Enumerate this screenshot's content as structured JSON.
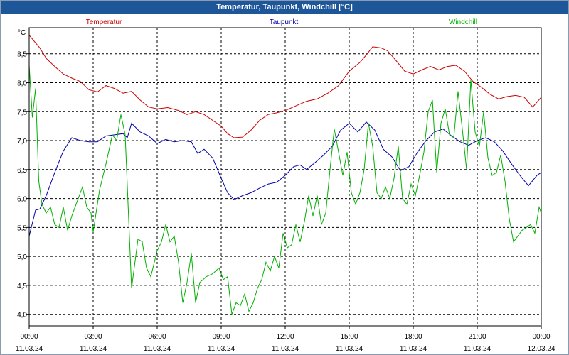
{
  "window": {
    "title": "Temperatur, Taupunkt, Windchill [°C]"
  },
  "chart_data": {
    "type": "line",
    "title": "Temperatur, Taupunkt, Windchill [°C]",
    "y_unit": "°C",
    "ylim": [
      3.8,
      8.95
    ],
    "y_ticks": [
      "4,0",
      "4,5",
      "5,0",
      "5,5",
      "6,0",
      "6,5",
      "7,0",
      "7,5",
      "8,0",
      "8,5"
    ],
    "y_tick_values": [
      4.0,
      4.5,
      5.0,
      5.5,
      6.0,
      6.5,
      7.0,
      7.5,
      8.0,
      8.5
    ],
    "x_range_hours": [
      0,
      24
    ],
    "x_ticks": [
      {
        "time": "00:00",
        "date": "11.03.24"
      },
      {
        "time": "03:00",
        "date": "11.03.24"
      },
      {
        "time": "06:00",
        "date": "11.03.24"
      },
      {
        "time": "09:00",
        "date": "11.03.24"
      },
      {
        "time": "12:00",
        "date": "11.03.24"
      },
      {
        "time": "15:00",
        "date": "11.03.24"
      },
      {
        "time": "18:00",
        "date": "11.03.24"
      },
      {
        "time": "21:00",
        "date": "11.03.24"
      },
      {
        "time": "00:00",
        "date": "12.03.24"
      }
    ],
    "grid": true,
    "legend_placement": "top",
    "series": [
      {
        "name": "Temperatur",
        "color": "#cc0000",
        "points": [
          [
            0,
            8.82
          ],
          [
            0.5,
            8.6
          ],
          [
            0.8,
            8.42
          ],
          [
            1.2,
            8.28
          ],
          [
            1.6,
            8.15
          ],
          [
            2.0,
            8.08
          ],
          [
            2.4,
            8.02
          ],
          [
            2.8,
            7.88
          ],
          [
            3.2,
            7.84
          ],
          [
            3.6,
            7.95
          ],
          [
            4.0,
            7.9
          ],
          [
            4.4,
            7.82
          ],
          [
            4.8,
            7.85
          ],
          [
            5.2,
            7.7
          ],
          [
            5.6,
            7.58
          ],
          [
            6.0,
            7.55
          ],
          [
            6.5,
            7.57
          ],
          [
            7.0,
            7.52
          ],
          [
            7.4,
            7.45
          ],
          [
            7.8,
            7.5
          ],
          [
            8.2,
            7.45
          ],
          [
            8.6,
            7.35
          ],
          [
            9.0,
            7.25
          ],
          [
            9.3,
            7.12
          ],
          [
            9.6,
            7.05
          ],
          [
            10.0,
            7.06
          ],
          [
            10.4,
            7.18
          ],
          [
            10.8,
            7.35
          ],
          [
            11.2,
            7.45
          ],
          [
            11.6,
            7.48
          ],
          [
            12.0,
            7.52
          ],
          [
            12.5,
            7.6
          ],
          [
            13.0,
            7.68
          ],
          [
            13.5,
            7.72
          ],
          [
            14.0,
            7.82
          ],
          [
            14.5,
            7.95
          ],
          [
            15.0,
            8.2
          ],
          [
            15.5,
            8.35
          ],
          [
            15.8,
            8.48
          ],
          [
            16.1,
            8.62
          ],
          [
            16.5,
            8.6
          ],
          [
            16.8,
            8.55
          ],
          [
            17.2,
            8.38
          ],
          [
            17.6,
            8.2
          ],
          [
            18.0,
            8.15
          ],
          [
            18.4,
            8.22
          ],
          [
            18.8,
            8.28
          ],
          [
            19.2,
            8.22
          ],
          [
            19.6,
            8.28
          ],
          [
            20.0,
            8.3
          ],
          [
            20.4,
            8.2
          ],
          [
            20.8,
            8.02
          ],
          [
            21.2,
            7.92
          ],
          [
            21.6,
            7.8
          ],
          [
            22.0,
            7.72
          ],
          [
            22.4,
            7.76
          ],
          [
            22.8,
            7.78
          ],
          [
            23.2,
            7.75
          ],
          [
            23.6,
            7.58
          ],
          [
            24.0,
            7.75
          ]
        ]
      },
      {
        "name": "Taupunkt",
        "color": "#0000aa",
        "points": [
          [
            0,
            5.35
          ],
          [
            0.3,
            5.8
          ],
          [
            0.5,
            5.82
          ],
          [
            0.8,
            6.05
          ],
          [
            1.2,
            6.45
          ],
          [
            1.6,
            6.82
          ],
          [
            2.0,
            7.05
          ],
          [
            2.4,
            7.0
          ],
          [
            2.8,
            6.98
          ],
          [
            3.2,
            6.98
          ],
          [
            3.6,
            7.08
          ],
          [
            4.0,
            7.1
          ],
          [
            4.4,
            7.12
          ],
          [
            4.6,
            7.05
          ],
          [
            4.8,
            7.3
          ],
          [
            5.2,
            7.15
          ],
          [
            5.6,
            7.08
          ],
          [
            6.0,
            6.95
          ],
          [
            6.4,
            7.02
          ],
          [
            6.8,
            6.98
          ],
          [
            7.2,
            7.0
          ],
          [
            7.6,
            6.98
          ],
          [
            7.9,
            6.78
          ],
          [
            8.2,
            6.85
          ],
          [
            8.6,
            6.7
          ],
          [
            9.0,
            6.35
          ],
          [
            9.3,
            6.1
          ],
          [
            9.6,
            5.98
          ],
          [
            10.0,
            6.05
          ],
          [
            10.4,
            6.1
          ],
          [
            10.8,
            6.18
          ],
          [
            11.2,
            6.25
          ],
          [
            11.6,
            6.28
          ],
          [
            12.0,
            6.4
          ],
          [
            12.4,
            6.55
          ],
          [
            12.7,
            6.58
          ],
          [
            13.0,
            6.5
          ],
          [
            13.4,
            6.62
          ],
          [
            13.8,
            6.75
          ],
          [
            14.2,
            6.9
          ],
          [
            14.6,
            7.18
          ],
          [
            15.0,
            7.3
          ],
          [
            15.4,
            7.15
          ],
          [
            15.8,
            7.32
          ],
          [
            16.2,
            7.18
          ],
          [
            16.6,
            6.85
          ],
          [
            17.0,
            6.72
          ],
          [
            17.4,
            6.48
          ],
          [
            17.8,
            6.55
          ],
          [
            18.2,
            6.8
          ],
          [
            18.6,
            7.0
          ],
          [
            19.0,
            7.15
          ],
          [
            19.4,
            7.2
          ],
          [
            19.8,
            7.08
          ],
          [
            20.2,
            6.98
          ],
          [
            20.6,
            6.92
          ],
          [
            21.0,
            7.0
          ],
          [
            21.4,
            7.05
          ],
          [
            21.8,
            6.98
          ],
          [
            22.2,
            6.82
          ],
          [
            22.6,
            6.6
          ],
          [
            23.0,
            6.4
          ],
          [
            23.4,
            6.22
          ],
          [
            23.8,
            6.4
          ],
          [
            24.0,
            6.45
          ]
        ]
      },
      {
        "name": "Windchill",
        "color": "#00b000",
        "points": [
          [
            0,
            8.3
          ],
          [
            0.15,
            7.4
          ],
          [
            0.3,
            7.9
          ],
          [
            0.45,
            6.3
          ],
          [
            0.6,
            5.9
          ],
          [
            0.8,
            5.75
          ],
          [
            1.0,
            5.85
          ],
          [
            1.2,
            5.55
          ],
          [
            1.4,
            5.5
          ],
          [
            1.6,
            5.85
          ],
          [
            1.8,
            5.45
          ],
          [
            2.0,
            5.7
          ],
          [
            2.2,
            5.9
          ],
          [
            2.5,
            6.2
          ],
          [
            2.7,
            5.85
          ],
          [
            2.9,
            5.75
          ],
          [
            3.0,
            5.42
          ],
          [
            3.3,
            6.15
          ],
          [
            3.6,
            6.6
          ],
          [
            3.9,
            7.1
          ],
          [
            4.1,
            7.0
          ],
          [
            4.3,
            7.45
          ],
          [
            4.5,
            7.1
          ],
          [
            4.8,
            4.45
          ],
          [
            5.1,
            5.3
          ],
          [
            5.3,
            5.25
          ],
          [
            5.5,
            4.8
          ],
          [
            5.7,
            4.65
          ],
          [
            6.0,
            5.1
          ],
          [
            6.2,
            5.25
          ],
          [
            6.4,
            5.55
          ],
          [
            6.6,
            5.25
          ],
          [
            6.8,
            5.35
          ],
          [
            7.0,
            4.9
          ],
          [
            7.2,
            4.2
          ],
          [
            7.4,
            4.55
          ],
          [
            7.6,
            5.05
          ],
          [
            7.8,
            4.2
          ],
          [
            8.0,
            4.55
          ],
          [
            8.3,
            4.65
          ],
          [
            8.6,
            4.7
          ],
          [
            8.9,
            4.8
          ],
          [
            9.1,
            4.6
          ],
          [
            9.3,
            4.65
          ],
          [
            9.5,
            4.0
          ],
          [
            9.7,
            4.2
          ],
          [
            9.9,
            4.15
          ],
          [
            10.1,
            4.35
          ],
          [
            10.3,
            4.05
          ],
          [
            10.5,
            4.2
          ],
          [
            10.7,
            4.45
          ],
          [
            10.9,
            4.6
          ],
          [
            11.1,
            4.9
          ],
          [
            11.3,
            4.75
          ],
          [
            11.5,
            5.0
          ],
          [
            11.7,
            4.8
          ],
          [
            11.9,
            5.4
          ],
          [
            12.1,
            5.15
          ],
          [
            12.3,
            5.2
          ],
          [
            12.5,
            5.55
          ],
          [
            12.7,
            5.25
          ],
          [
            12.9,
            5.6
          ],
          [
            13.1,
            6.05
          ],
          [
            13.3,
            5.7
          ],
          [
            13.5,
            6.05
          ],
          [
            13.7,
            5.55
          ],
          [
            13.9,
            5.75
          ],
          [
            14.1,
            6.5
          ],
          [
            14.3,
            7.2
          ],
          [
            14.5,
            6.8
          ],
          [
            14.7,
            6.4
          ],
          [
            14.9,
            6.8
          ],
          [
            15.1,
            6.1
          ],
          [
            15.3,
            5.9
          ],
          [
            15.5,
            6.1
          ],
          [
            15.7,
            6.5
          ],
          [
            15.9,
            7.3
          ],
          [
            16.1,
            6.9
          ],
          [
            16.3,
            6.1
          ],
          [
            16.5,
            6.0
          ],
          [
            16.7,
            6.2
          ],
          [
            16.9,
            6.0
          ],
          [
            17.1,
            6.35
          ],
          [
            17.3,
            6.9
          ],
          [
            17.5,
            6.0
          ],
          [
            17.7,
            5.9
          ],
          [
            17.9,
            6.25
          ],
          [
            18.1,
            6.05
          ],
          [
            18.3,
            6.4
          ],
          [
            18.5,
            6.8
          ],
          [
            18.7,
            7.5
          ],
          [
            18.9,
            7.7
          ],
          [
            19.1,
            6.45
          ],
          [
            19.3,
            7.3
          ],
          [
            19.5,
            7.55
          ],
          [
            19.7,
            7.1
          ],
          [
            19.9,
            7.05
          ],
          [
            20.1,
            7.85
          ],
          [
            20.3,
            7.2
          ],
          [
            20.5,
            6.5
          ],
          [
            20.7,
            8.05
          ],
          [
            20.9,
            7.15
          ],
          [
            21.1,
            6.9
          ],
          [
            21.3,
            7.5
          ],
          [
            21.5,
            6.7
          ],
          [
            21.7,
            6.4
          ],
          [
            21.9,
            6.45
          ],
          [
            22.1,
            6.75
          ],
          [
            22.3,
            6.3
          ],
          [
            22.5,
            5.65
          ],
          [
            22.7,
            5.25
          ],
          [
            22.9,
            5.35
          ],
          [
            23.1,
            5.45
          ],
          [
            23.3,
            5.5
          ],
          [
            23.5,
            5.55
          ],
          [
            23.7,
            5.4
          ],
          [
            23.9,
            5.85
          ],
          [
            24.0,
            5.75
          ]
        ]
      }
    ]
  }
}
